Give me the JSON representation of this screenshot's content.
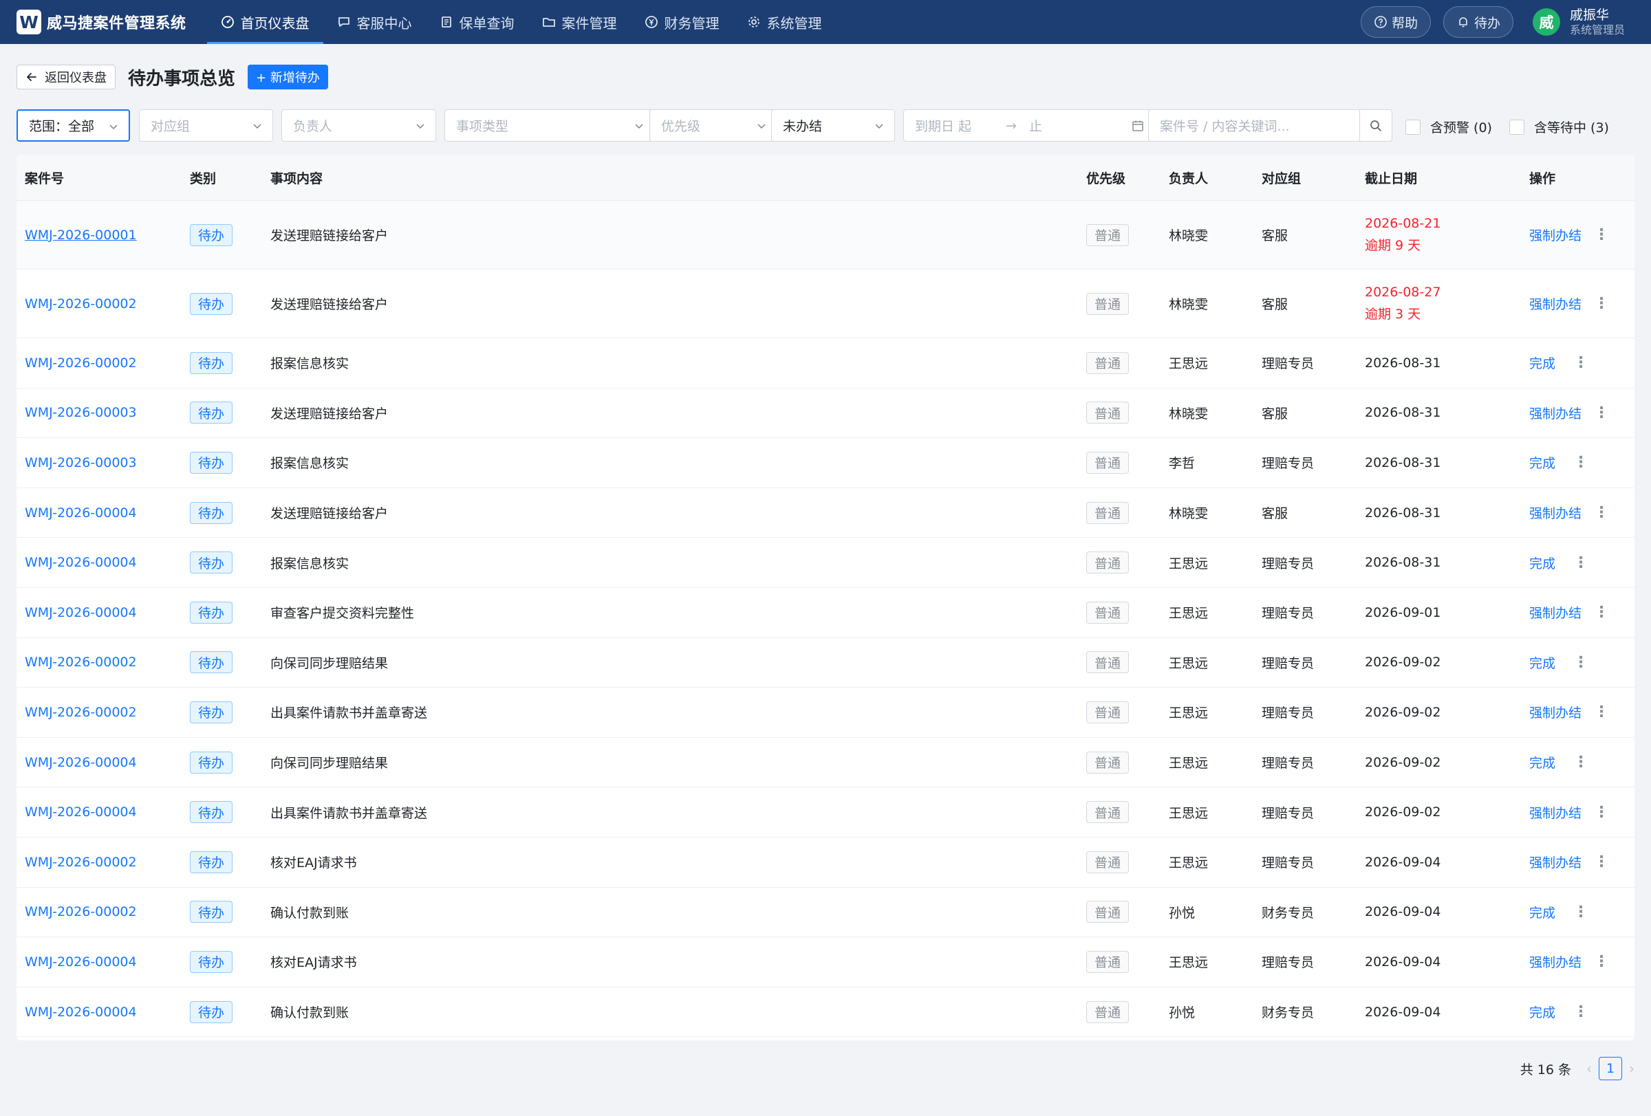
{
  "app": {
    "title": "威马捷案件管理系统",
    "logo": "W"
  },
  "nav": [
    {
      "label": "首页仪表盘",
      "icon": "dashboard-icon"
    },
    {
      "label": "客服中心",
      "icon": "chat-icon"
    },
    {
      "label": "保单查询",
      "icon": "document-icon"
    },
    {
      "label": "案件管理",
      "icon": "folder-icon"
    },
    {
      "label": "财务管理",
      "icon": "yen-icon"
    },
    {
      "label": "系统管理",
      "icon": "gear-icon"
    }
  ],
  "header": {
    "help_label": "帮助",
    "todo_label": "待办",
    "avatar_char": "威",
    "user_name": "戚振华",
    "user_role": "系统管理员"
  },
  "page": {
    "back_label": "返回仪表盘",
    "title": "待办事项总览",
    "add_label": "+ 新增待办"
  },
  "filters": {
    "scope": "范围：全部",
    "group_placeholder": "对应组",
    "assignee_placeholder": "负责人",
    "type_placeholder": "事项类型",
    "priority_placeholder": "优先级",
    "status_value": "未办结",
    "date_start_placeholder": "到期日 起",
    "date_arrow": "→",
    "date_end_placeholder": "止",
    "search_placeholder": "案件号 / 内容关键词...",
    "warning_label": "含预警 (0)",
    "waiting_label": "含等待中 (3)"
  },
  "table": {
    "headers": {
      "case_no": "案件号",
      "category": "类别",
      "content": "事项内容",
      "priority": "优先级",
      "assignee": "负责人",
      "group": "对应组",
      "deadline": "截止日期",
      "action": "操作"
    },
    "rows": [
      {
        "case_no": "WMJ-2026-00001",
        "category": "待办",
        "content": "发送理赔链接给客户",
        "priority": "普通",
        "assignee": "林晓雯",
        "group": "客服",
        "deadline": "2026-08-21",
        "overdue": "逾期 9 天",
        "action": "强制办结"
      },
      {
        "case_no": "WMJ-2026-00002",
        "category": "待办",
        "content": "发送理赔链接给客户",
        "priority": "普通",
        "assignee": "林晓雯",
        "group": "客服",
        "deadline": "2026-08-27",
        "overdue": "逾期 3 天",
        "action": "强制办结"
      },
      {
        "case_no": "WMJ-2026-00002",
        "category": "待办",
        "content": "报案信息核实",
        "priority": "普通",
        "assignee": "王思远",
        "group": "理赔专员",
        "deadline": "2026-08-31",
        "action": "完成"
      },
      {
        "case_no": "WMJ-2026-00003",
        "category": "待办",
        "content": "发送理赔链接给客户",
        "priority": "普通",
        "assignee": "林晓雯",
        "group": "客服",
        "deadline": "2026-08-31",
        "action": "强制办结"
      },
      {
        "case_no": "WMJ-2026-00003",
        "category": "待办",
        "content": "报案信息核实",
        "priority": "普通",
        "assignee": "李哲",
        "group": "理赔专员",
        "deadline": "2026-08-31",
        "action": "完成"
      },
      {
        "case_no": "WMJ-2026-00004",
        "category": "待办",
        "content": "发送理赔链接给客户",
        "priority": "普通",
        "assignee": "林晓雯",
        "group": "客服",
        "deadline": "2026-08-31",
        "action": "强制办结"
      },
      {
        "case_no": "WMJ-2026-00004",
        "category": "待办",
        "content": "报案信息核实",
        "priority": "普通",
        "assignee": "王思远",
        "group": "理赔专员",
        "deadline": "2026-08-31",
        "action": "完成"
      },
      {
        "case_no": "WMJ-2026-00004",
        "category": "待办",
        "content": "审查客户提交资料完整性",
        "priority": "普通",
        "assignee": "王思远",
        "group": "理赔专员",
        "deadline": "2026-09-01",
        "action": "强制办结"
      },
      {
        "case_no": "WMJ-2026-00002",
        "category": "待办",
        "content": "向保司同步理赔结果",
        "priority": "普通",
        "assignee": "王思远",
        "group": "理赔专员",
        "deadline": "2026-09-02",
        "action": "完成"
      },
      {
        "case_no": "WMJ-2026-00002",
        "category": "待办",
        "content": "出具案件请款书并盖章寄送",
        "priority": "普通",
        "assignee": "王思远",
        "group": "理赔专员",
        "deadline": "2026-09-02",
        "action": "强制办结"
      },
      {
        "case_no": "WMJ-2026-00004",
        "category": "待办",
        "content": "向保司同步理赔结果",
        "priority": "普通",
        "assignee": "王思远",
        "group": "理赔专员",
        "deadline": "2026-09-02",
        "action": "完成"
      },
      {
        "case_no": "WMJ-2026-00004",
        "category": "待办",
        "content": "出具案件请款书并盖章寄送",
        "priority": "普通",
        "assignee": "王思远",
        "group": "理赔专员",
        "deadline": "2026-09-02",
        "action": "强制办结"
      },
      {
        "case_no": "WMJ-2026-00002",
        "category": "待办",
        "content": "核对EAJ请求书",
        "priority": "普通",
        "assignee": "王思远",
        "group": "理赔专员",
        "deadline": "2026-09-04",
        "action": "强制办结"
      },
      {
        "case_no": "WMJ-2026-00002",
        "category": "待办",
        "content": "确认付款到账",
        "priority": "普通",
        "assignee": "孙悦",
        "group": "财务专员",
        "deadline": "2026-09-04",
        "action": "完成"
      },
      {
        "case_no": "WMJ-2026-00004",
        "category": "待办",
        "content": "核对EAJ请求书",
        "priority": "普通",
        "assignee": "王思远",
        "group": "理赔专员",
        "deadline": "2026-09-04",
        "action": "强制办结"
      },
      {
        "case_no": "WMJ-2026-00004",
        "category": "待办",
        "content": "确认付款到账",
        "priority": "普通",
        "assignee": "孙悦",
        "group": "财务专员",
        "deadline": "2026-09-04",
        "action": "完成"
      }
    ]
  },
  "pagination": {
    "total_label": "共 16 条",
    "current_page": "1",
    "prev": "‹",
    "next": "›"
  },
  "more_glyph": "⋮",
  "colors": {
    "primary": "#1677ff",
    "header_bg": "#1d3e72",
    "overdue": "#f5222d",
    "avatar": "#21b36a"
  }
}
